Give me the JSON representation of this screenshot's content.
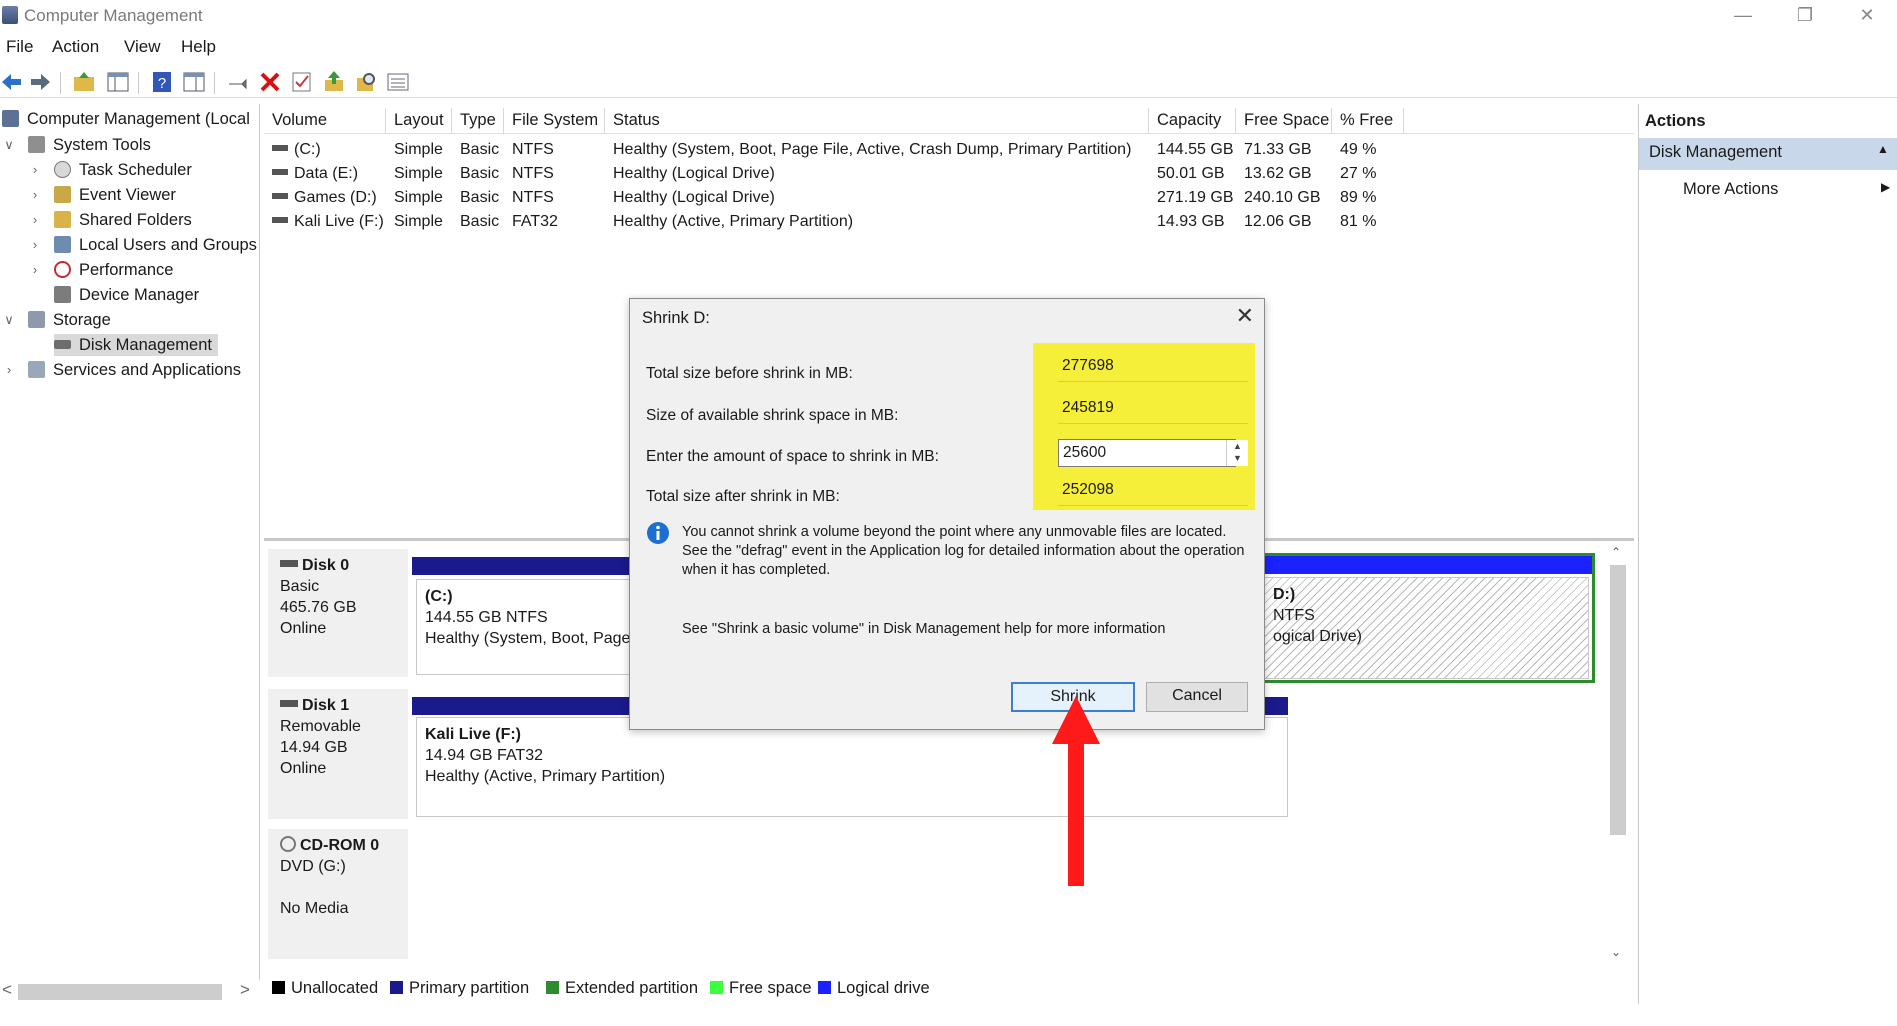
{
  "window": {
    "title": "Computer Management"
  },
  "menu": [
    "File",
    "Action",
    "View",
    "Help"
  ],
  "tree": {
    "root": "Computer Management (Local",
    "items": [
      "System Tools",
      "Task Scheduler",
      "Event Viewer",
      "Shared Folders",
      "Local Users and Groups",
      "Performance",
      "Device Manager",
      "Storage",
      "Disk Management",
      "Services and Applications"
    ]
  },
  "volumes": {
    "columns": [
      "Volume",
      "Layout",
      "Type",
      "File System",
      "Status",
      "Capacity",
      "Free Space",
      "% Free"
    ],
    "rows": [
      [
        "(C:)",
        "Simple",
        "Basic",
        "NTFS",
        "Healthy (System, Boot, Page File, Active, Crash Dump, Primary Partition)",
        "144.55 GB",
        "71.33 GB",
        "49 %"
      ],
      [
        "Data (E:)",
        "Simple",
        "Basic",
        "NTFS",
        "Healthy (Logical Drive)",
        "50.01 GB",
        "13.62 GB",
        "27 %"
      ],
      [
        "Games (D:)",
        "Simple",
        "Basic",
        "NTFS",
        "Healthy (Logical Drive)",
        "271.19 GB",
        "240.10 GB",
        "89 %"
      ],
      [
        "Kali Live (F:)",
        "Simple",
        "Basic",
        "FAT32",
        "Healthy (Active, Primary Partition)",
        "14.93 GB",
        "12.06 GB",
        "81 %"
      ]
    ]
  },
  "disks": [
    {
      "name": "Disk 0",
      "type": "Basic",
      "size": "465.76 GB",
      "state": "Online",
      "part_name": "(C:)",
      "part_size": "144.55 GB NTFS",
      "part_status": "Healthy (System, Boot, Page",
      "right_part_name": "D:)",
      "right_part_size": "NTFS",
      "right_part_status": "ogical Drive)"
    },
    {
      "name": "Disk 1",
      "type": "Removable",
      "size": "14.94 GB",
      "state": "Online",
      "part_name": "Kali Live  (F:)",
      "part_size": "14.94 GB FAT32",
      "part_status": "Healthy (Active, Primary Partition)"
    },
    {
      "name": "CD-ROM 0",
      "type": "DVD (G:)",
      "state": "No Media"
    }
  ],
  "legend": [
    "Unallocated",
    "Primary partition",
    "Extended partition",
    "Free space",
    "Logical drive"
  ],
  "colors": {
    "unallocated": "#000000",
    "primary": "#1a1a8c",
    "extended": "#2e8b2e",
    "free": "#3cff3c",
    "logical": "#1a22ff",
    "highlight": "#f5ef3a",
    "arrow": "#ff1a1a"
  },
  "actions": {
    "header": "Actions",
    "section": "Disk Management",
    "more": "More Actions"
  },
  "dialog": {
    "title": "Shrink D:",
    "total_before_label": "Total size before shrink in MB:",
    "total_before_value": "277698",
    "available_label": "Size of available shrink space in MB:",
    "available_value": "245819",
    "amount_label": "Enter the amount of space to shrink in MB:",
    "amount_value": "25600",
    "total_after_label": "Total size after shrink in MB:",
    "total_after_value": "252098",
    "info_text": "You cannot shrink a volume beyond the point where any unmovable files are located. See the \"defrag\" event in the Application log for detailed information about the operation when it has completed.",
    "help_text": "See \"Shrink a basic volume\" in Disk Management help for more information",
    "shrink_label": "Shrink",
    "cancel_label": "Cancel"
  }
}
